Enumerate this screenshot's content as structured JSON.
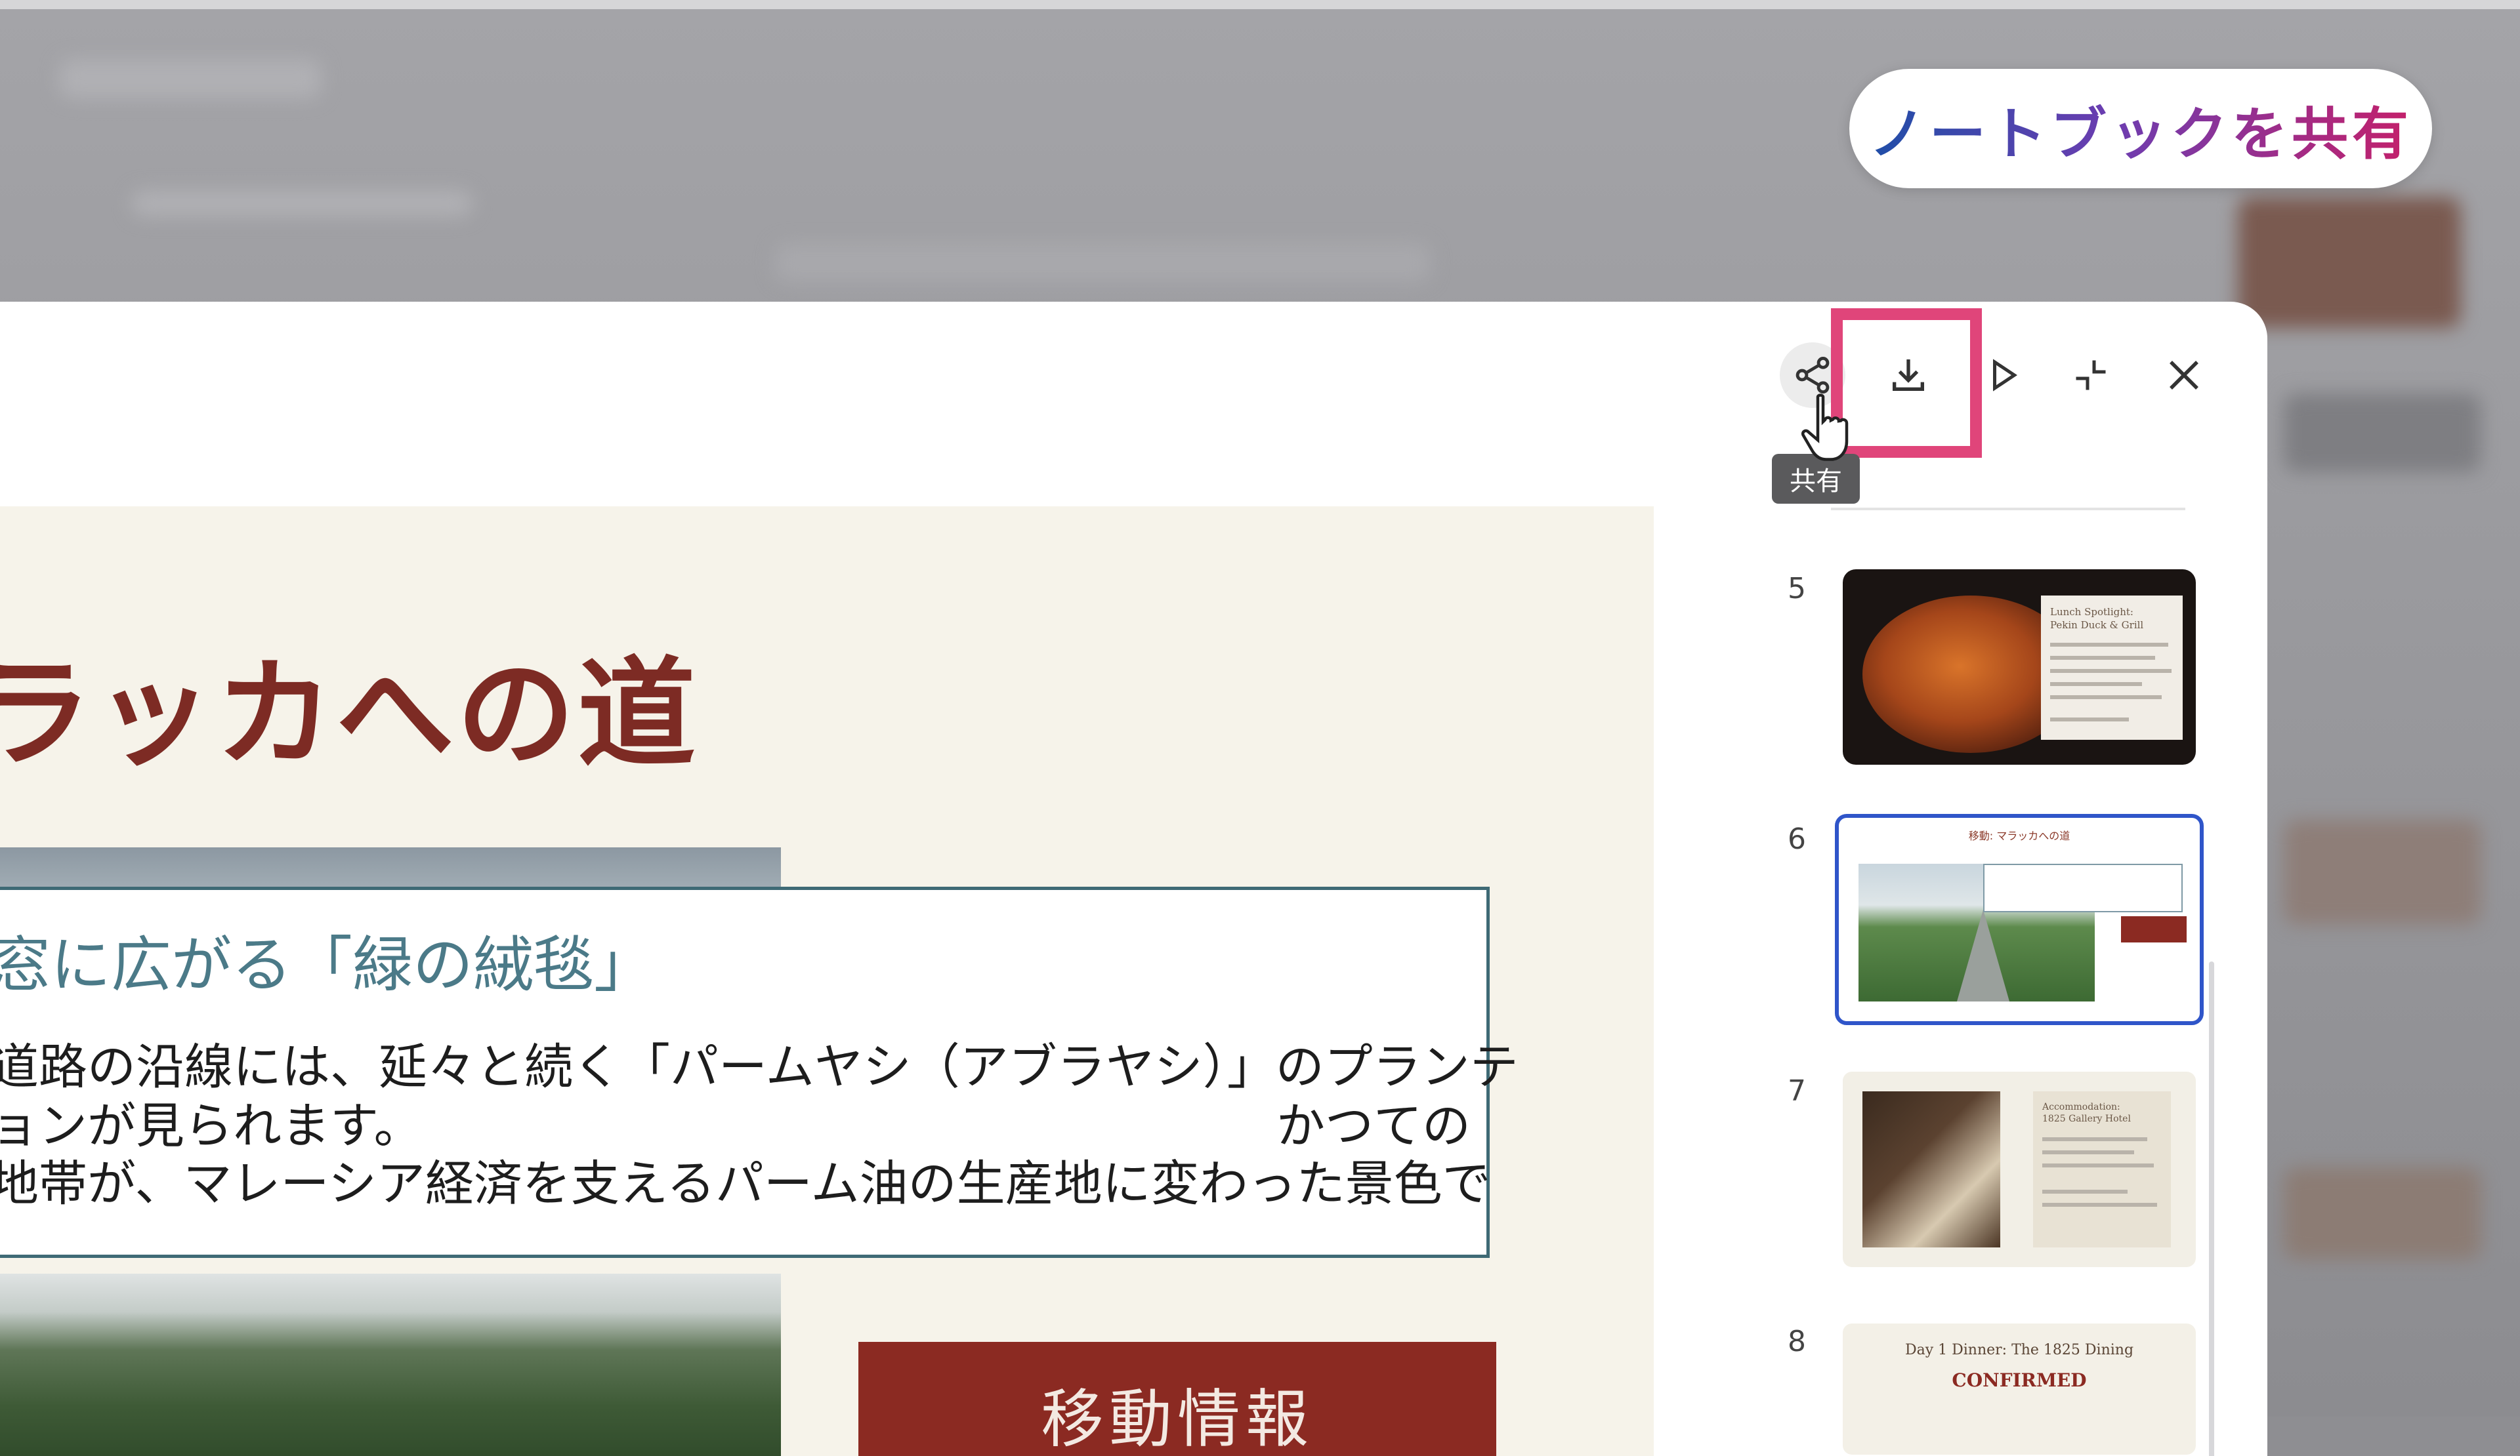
{
  "background": {
    "share_notebook_label": "ノートブックを共有"
  },
  "toolbar": {
    "share_tooltip": "共有",
    "icons": [
      "share-icon",
      "download-icon",
      "play-icon",
      "collapse-icon",
      "close-icon"
    ]
  },
  "slide": {
    "title": "ラッカへの道",
    "subheading": "窓に広がる「緑の絨毯」",
    "body_lines": [
      "道路の沿線には、延々と続く「パームヤシ（アブラヤシ）」のプランテ",
      "ョンが見られます。",
      "かつての",
      "地帯が、マレーシア経済を支えるパーム油の生産地に変わった景色で"
    ],
    "info_button": "移動情報"
  },
  "thumbnails": [
    {
      "number": "5",
      "lines": [
        "Lunch Spotlight:",
        "Pekin Duck & Grill"
      ]
    },
    {
      "number": "6",
      "title": "移動: マラッカへの道"
    },
    {
      "number": "7",
      "lines": [
        "Accommodation:",
        "1825 Gallery Hotel"
      ]
    },
    {
      "number": "8",
      "lines": [
        "Day 1 Dinner: The 1825 Dining",
        "CONFIRMED"
      ]
    }
  ],
  "colors": {
    "highlight": "#e0457a",
    "title_red": "#7d2b24",
    "selected_border": "#2f55c9",
    "info_button": "#8b2a22"
  }
}
